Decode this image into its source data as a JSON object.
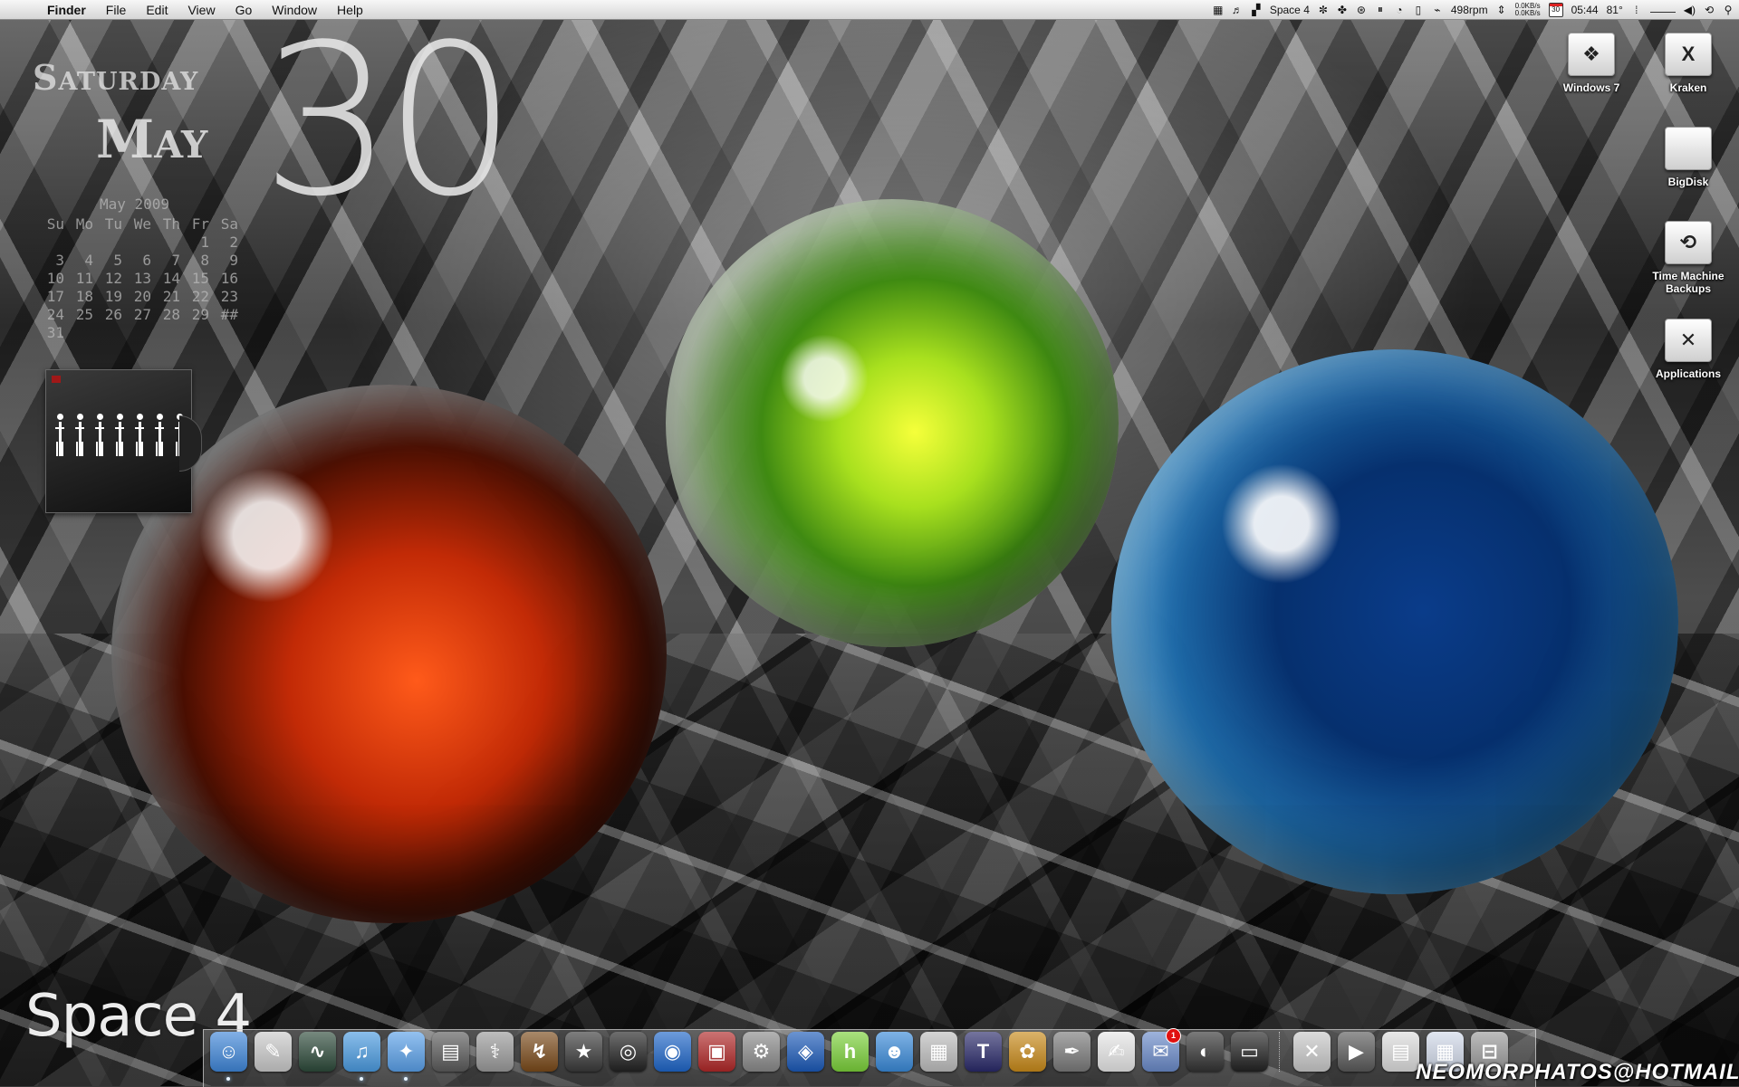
{
  "menubar": {
    "apple_icon": "apple-logo-icon",
    "items": [
      "Finder",
      "File",
      "Edit",
      "View",
      "Go",
      "Window",
      "Help"
    ],
    "status": {
      "space": "Space 4",
      "fan": "498rpm",
      "net_up": "0.0KB/s",
      "net_down": "0.0KB/s",
      "cal_day": "30",
      "time": "05:44",
      "temp": "81°"
    }
  },
  "date_widget": {
    "day": "Saturday",
    "month": "May",
    "date": "30",
    "calendar": {
      "title": "May 2009",
      "headers": [
        "Su",
        "Mo",
        "Tu",
        "We",
        "Th",
        "Fr",
        "Sa"
      ],
      "weeks": [
        [
          "",
          "",
          "",
          "",
          "",
          "1",
          "2"
        ],
        [
          "3",
          "4",
          "5",
          "6",
          "7",
          "8",
          "9"
        ],
        [
          "10",
          "11",
          "12",
          "13",
          "14",
          "15",
          "16"
        ],
        [
          "17",
          "18",
          "19",
          "20",
          "21",
          "22",
          "23"
        ],
        [
          "24",
          "25",
          "26",
          "27",
          "28",
          "29",
          "##"
        ],
        [
          "31",
          "",
          "",
          "",
          "",
          "",
          ""
        ]
      ]
    }
  },
  "desktop_icons": [
    {
      "label": "Windows 7",
      "icon": "windows-drive-icon",
      "glyph": "❖"
    },
    {
      "label": "Kraken",
      "icon": "x-drive-icon",
      "glyph": "X"
    },
    {
      "label": "BigDisk",
      "icon": "hard-disk-icon",
      "glyph": ""
    },
    {
      "label": "Time Machine Backups",
      "icon": "time-machine-icon",
      "glyph": "⟲"
    },
    {
      "label": "Applications",
      "icon": "applications-folder-icon",
      "glyph": "✕"
    }
  ],
  "space_label": "Space 4",
  "dock": {
    "items": [
      {
        "name": "finder",
        "color": "#3f86d8",
        "glyph": "☺",
        "running": true
      },
      {
        "name": "preview",
        "color": "#c9c9c9",
        "glyph": "✎",
        "running": false
      },
      {
        "name": "activity-monitor",
        "color": "#2d4a3a",
        "glyph": "∿",
        "running": false
      },
      {
        "name": "itunes",
        "color": "#4b9be0",
        "glyph": "♫",
        "running": true
      },
      {
        "name": "safari",
        "color": "#5aa0e8",
        "glyph": "✦",
        "running": true
      },
      {
        "name": "mail-stamp",
        "color": "#5b5b5b",
        "glyph": "▤",
        "running": false
      },
      {
        "name": "disk-utility",
        "color": "#9a9a9a",
        "glyph": "⚕",
        "running": false
      },
      {
        "name": "transmit",
        "color": "#7a4a1a",
        "glyph": "↯",
        "running": false
      },
      {
        "name": "imovie",
        "color": "#3a3a3a",
        "glyph": "★",
        "running": false
      },
      {
        "name": "aperture",
        "color": "#222222",
        "glyph": "◎",
        "running": false
      },
      {
        "name": "photo-booth",
        "color": "#1f66c8",
        "glyph": "◉",
        "running": false
      },
      {
        "name": "vmware",
        "color": "#b02828",
        "glyph": "▣",
        "running": false
      },
      {
        "name": "system-preferences",
        "color": "#8a8a8a",
        "glyph": "⚙",
        "running": false
      },
      {
        "name": "quicktime",
        "color": "#1c5ab8",
        "glyph": "◈",
        "running": false
      },
      {
        "name": "hulu",
        "color": "#7bd03a",
        "glyph": "h",
        "running": false
      },
      {
        "name": "ichat",
        "color": "#3a8ad8",
        "glyph": "☻",
        "running": false
      },
      {
        "name": "calculator",
        "color": "#bdbdbd",
        "glyph": "▦",
        "running": false
      },
      {
        "name": "final-cut",
        "color": "#2a2a6a",
        "glyph": "T",
        "running": false
      },
      {
        "name": "adium",
        "color": "#c88a1a",
        "glyph": "✿",
        "running": false
      },
      {
        "name": "script-editor",
        "color": "#7a7a7a",
        "glyph": "✒",
        "running": false
      },
      {
        "name": "textedit",
        "color": "#e6e6e6",
        "glyph": "✍",
        "running": false
      },
      {
        "name": "mail",
        "color": "#6a8ac8",
        "glyph": "✉",
        "running": false,
        "badge": "1"
      },
      {
        "name": "dashboard",
        "color": "#333333",
        "glyph": "◐",
        "running": false
      },
      {
        "name": "terminal",
        "color": "#222222",
        "glyph": "▭",
        "running": false
      },
      {
        "name": "applications-stack",
        "color": "#c8c8c8",
        "glyph": "✕",
        "running": false
      },
      {
        "name": "camera",
        "color": "#5a5a5a",
        "glyph": "▶",
        "running": false
      },
      {
        "name": "documents-stack",
        "color": "#dcdcdc",
        "glyph": "▤",
        "running": false
      },
      {
        "name": "downloads-stack",
        "color": "#d0d8e8",
        "glyph": "▦",
        "running": false
      },
      {
        "name": "trash",
        "color": "#9a9a9a",
        "glyph": "⊟",
        "running": false
      }
    ]
  },
  "email_watermark": "NEOMORPHATOS@HOTMAIL.IT"
}
